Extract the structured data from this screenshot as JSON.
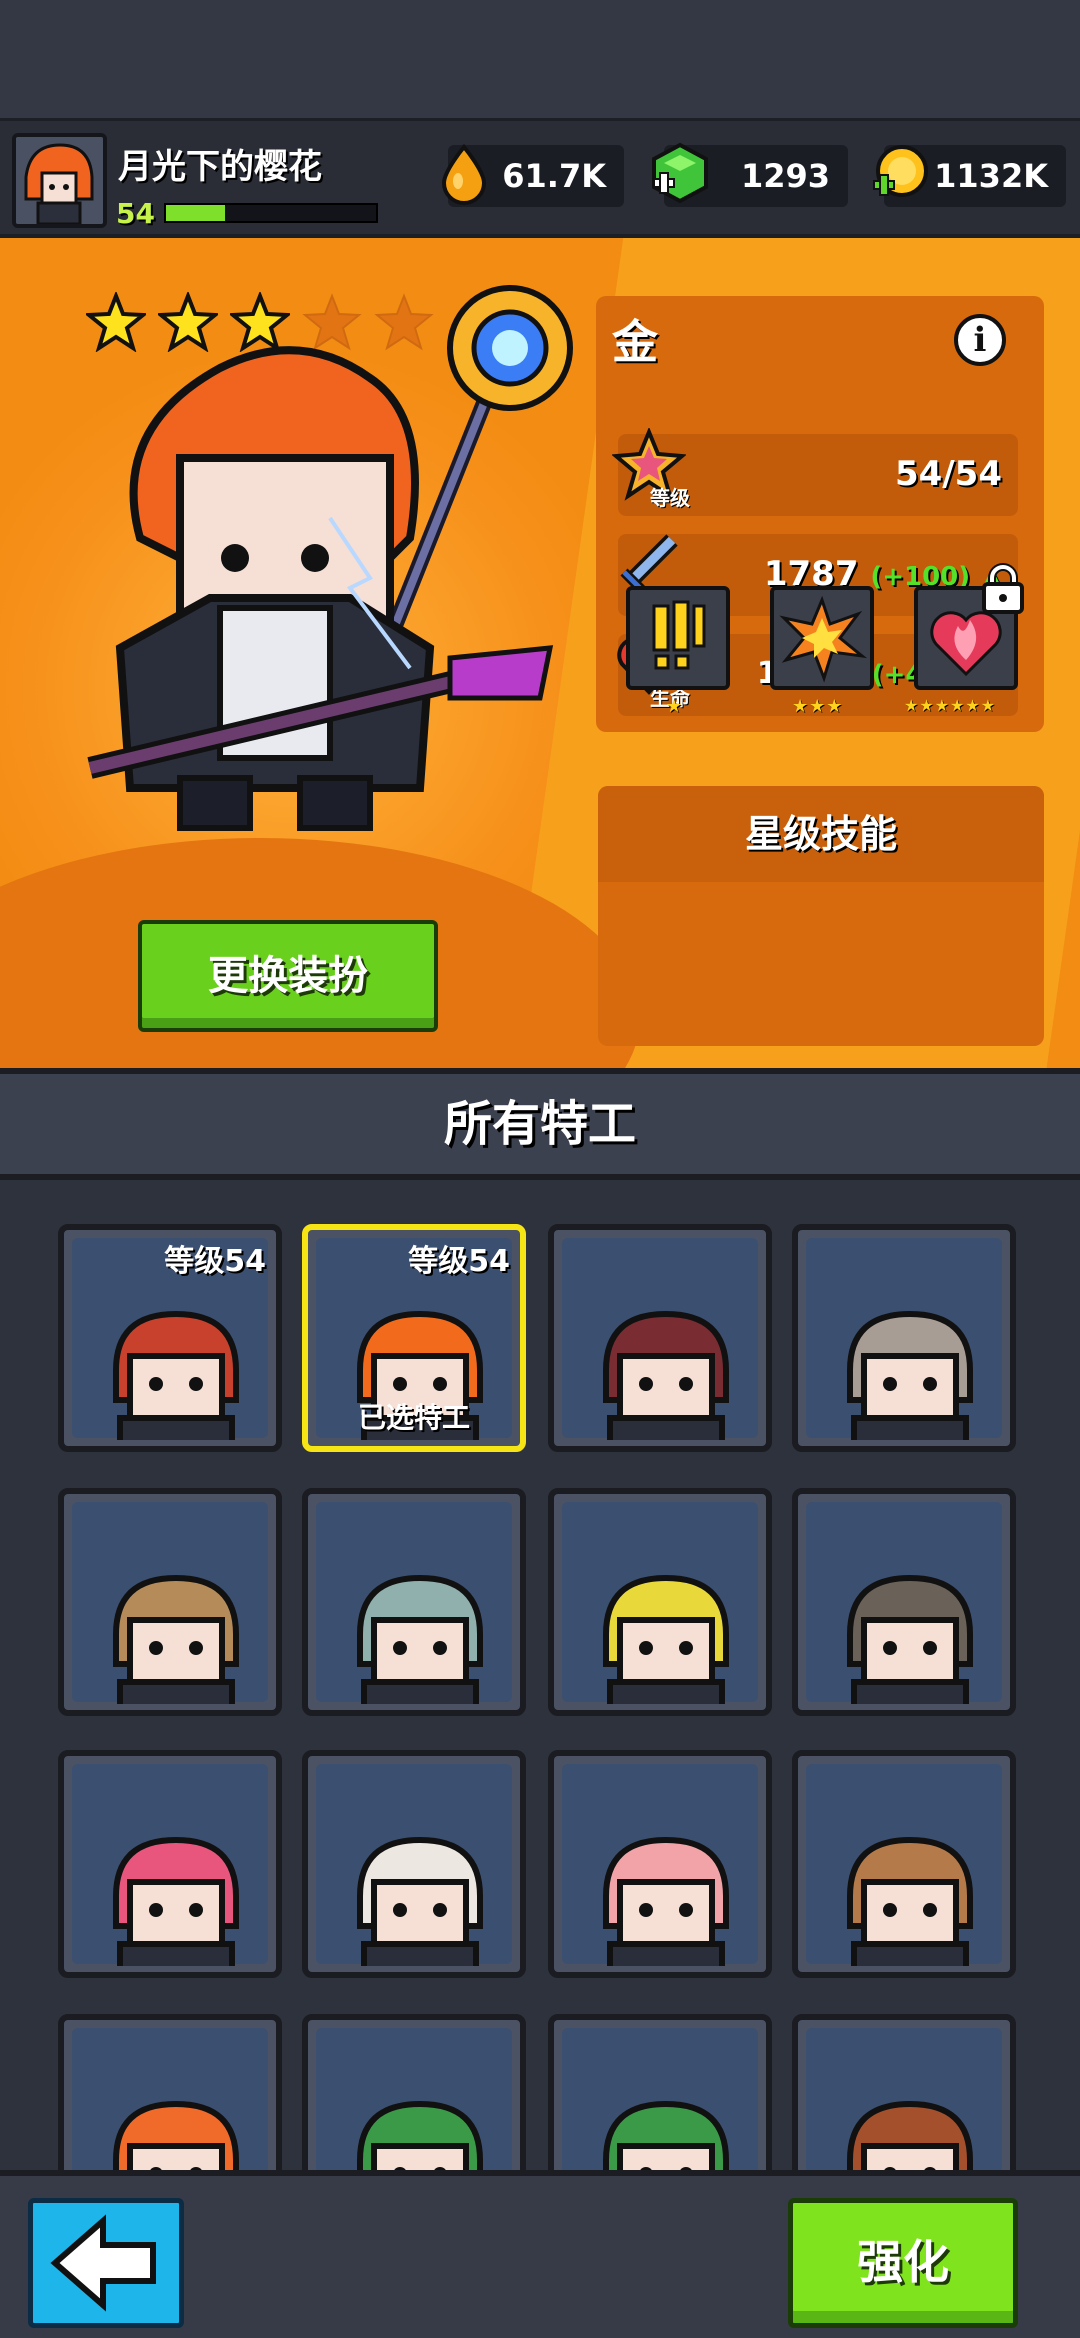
{
  "header": {
    "player_name": "月光下的樱花",
    "level": "54",
    "xp_fraction": 0.28,
    "resources": [
      {
        "name": "oil-drop-icon",
        "value": "61.7K"
      },
      {
        "name": "green-gem-icon",
        "value": "1293"
      },
      {
        "name": "gold-coin-icon",
        "value": "1132K"
      }
    ]
  },
  "hero": {
    "name": "金",
    "stars_filled": 3,
    "stars_total": 5,
    "stats": {
      "level_label": "等级",
      "level_value": "54/54",
      "attack_label": "攻击",
      "attack_value": "1787",
      "attack_bonus": "(+100)",
      "hp_label": "生命",
      "hp_value": "10054",
      "hp_bonus": "(+460)"
    },
    "skills_title": "星级技能",
    "skills": [
      {
        "icon": "exclamation-icon",
        "stars": "★"
      },
      {
        "icon": "explosion-icon",
        "stars": "★★★"
      },
      {
        "icon": "flame-heart-icon",
        "stars": "★★★★★★",
        "locked": true
      }
    ],
    "change_outfit_label": "更换装扮"
  },
  "section_title": "所有特工",
  "agents": [
    {
      "level": "等级54",
      "selected": false,
      "color": "#c8412d"
    },
    {
      "level": "等级54",
      "selected": true,
      "status": "已选特工",
      "color": "#f26a1c"
    },
    {
      "level": "",
      "color": "#7a2c33"
    },
    {
      "level": "",
      "color": "#a89d94"
    },
    {
      "level": "",
      "color": "#b58b5a"
    },
    {
      "level": "",
      "color": "#8fb0ad"
    },
    {
      "level": "",
      "color": "#e9d83a"
    },
    {
      "level": "",
      "color": "#6a6158"
    },
    {
      "level": "",
      "color": "#e8567e"
    },
    {
      "level": "",
      "color": "#ece7e0"
    },
    {
      "level": "",
      "color": "#f2a3a8"
    },
    {
      "level": "",
      "color": "#b47a4a"
    },
    {
      "level": "",
      "color": "#f06a2a"
    },
    {
      "level": "",
      "color": "#3b9a48"
    },
    {
      "level": "",
      "color": "#3b9a48"
    },
    {
      "level": "",
      "color": "#a4502c"
    }
  ],
  "footer": {
    "upgrade_label": "强化"
  },
  "colors": {
    "hero_bg": "#f28c12",
    "accent_green": "#7fe41d",
    "back_blue": "#1eb5ea",
    "selected_border": "#f7e414"
  }
}
